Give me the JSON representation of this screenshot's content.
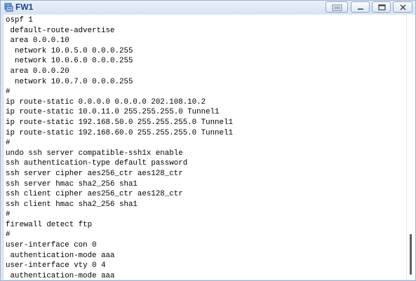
{
  "window": {
    "title": "FW1",
    "icon": "terminal-app-icon",
    "controls": [
      "extra-icon",
      "minimize-icon",
      "maximize-icon",
      "close-icon"
    ]
  },
  "terminal": {
    "lines": [
      "ospf 1",
      " default-route-advertise",
      " area 0.0.0.10",
      "  network 10.0.5.0 0.0.0.255",
      "  network 10.0.6.0 0.0.0.255",
      " area 0.0.0.20",
      "  network 10.0.7.0 0.0.0.255",
      "#",
      "ip route-static 0.0.0.0 0.0.0.0 202.108.10.2",
      "ip route-static 10.0.11.0 255.255.255.0 Tunnel1",
      "ip route-static 192.168.50.0 255.255.255.0 Tunnel1",
      "ip route-static 192.168.60.0 255.255.255.0 Tunnel1",
      "#",
      "undo ssh server compatible-ssh1x enable",
      "ssh authentication-type default password",
      "ssh server cipher aes256_ctr aes128_ctr",
      "ssh server hmac sha2_256 sha1",
      "ssh client cipher aes256_ctr aes128_ctr",
      "ssh client hmac sha2_256 sha1",
      "#",
      "firewall detect ftp",
      "#",
      "user-interface con 0",
      " authentication-mode aaa",
      "user-interface vty 0 4",
      " authentication-mode aaa"
    ]
  }
}
